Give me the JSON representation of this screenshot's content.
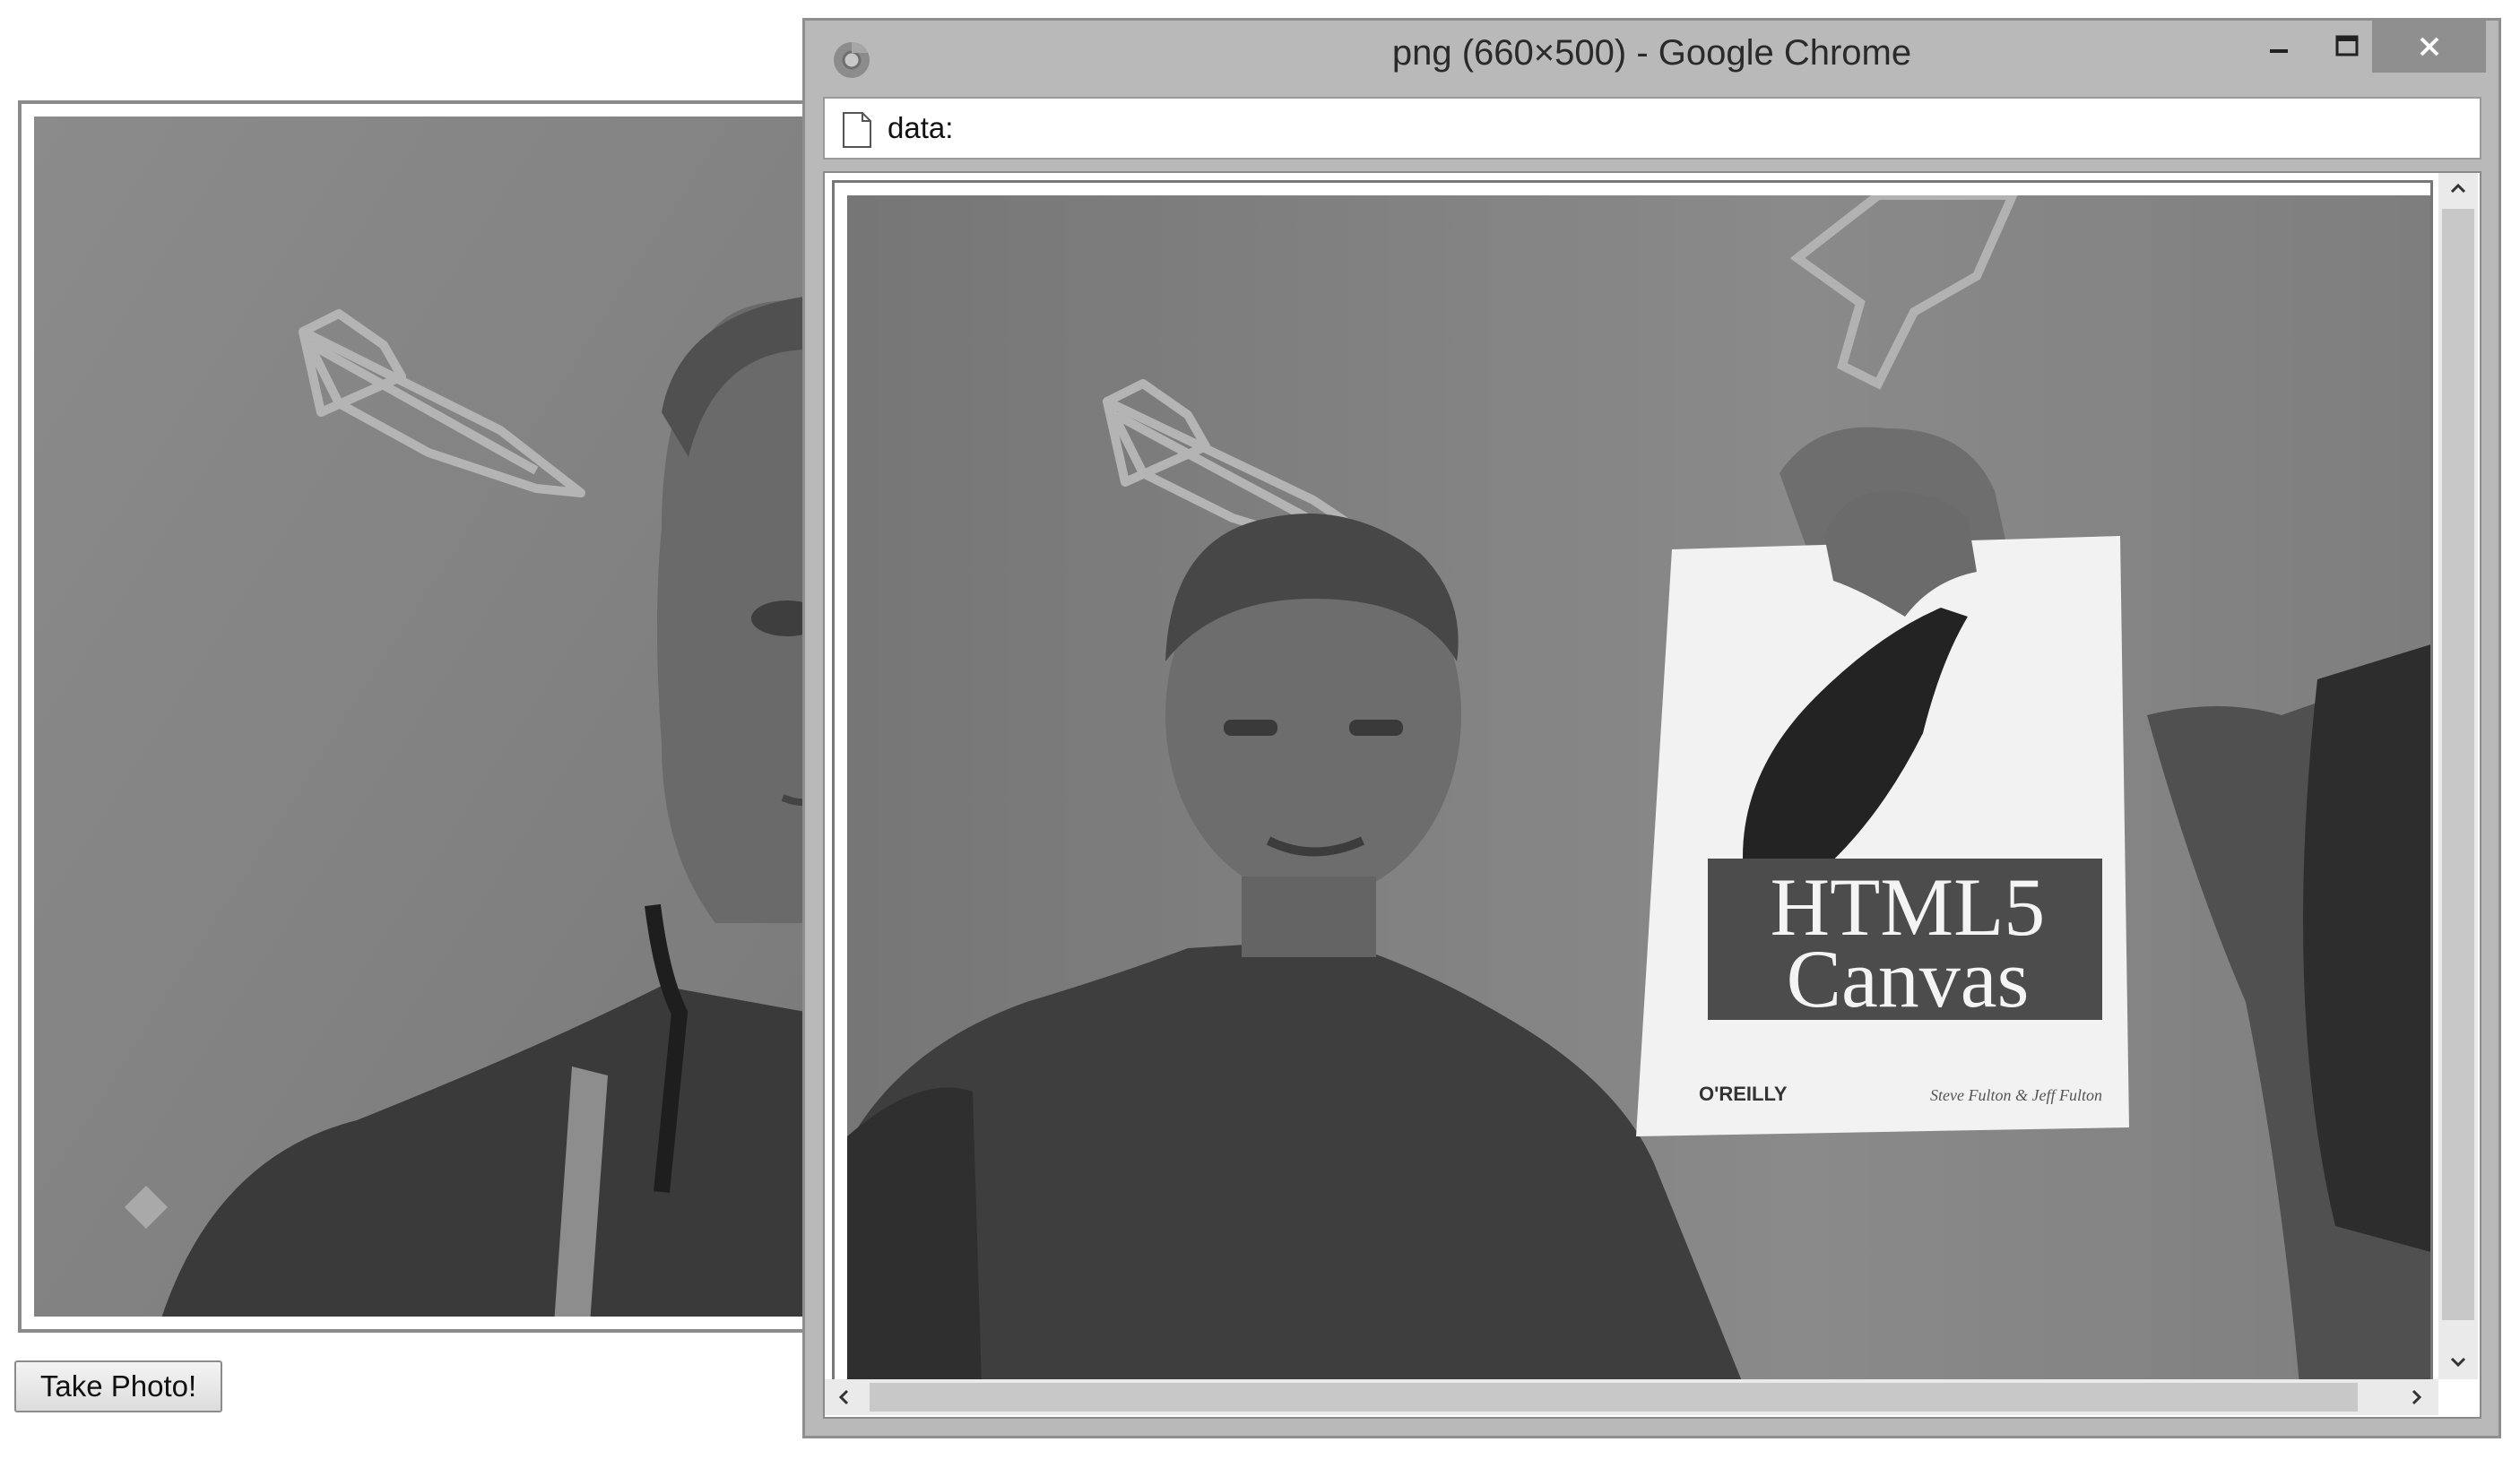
{
  "app": {
    "take_photo_label": "Take Photo!"
  },
  "window": {
    "title": "png (660×500) - Google Chrome",
    "address": "data:"
  },
  "book": {
    "title_line1": "HTML5",
    "title_line2": "Canvas",
    "publisher": "O'REILLY",
    "authors": "Steve Fulton & Jeff Fulton"
  },
  "colors": {
    "window_frame": "#b9b9b9",
    "close_button": "#8f8f8f",
    "photo_wall": "#7d7d7d",
    "photo_band": "#555555"
  },
  "icons": [
    "chrome-icon",
    "minimize-icon",
    "maximize-icon",
    "close-icon",
    "page-icon",
    "scroll-up-icon",
    "scroll-down-icon",
    "scroll-left-icon",
    "scroll-right-icon"
  ]
}
